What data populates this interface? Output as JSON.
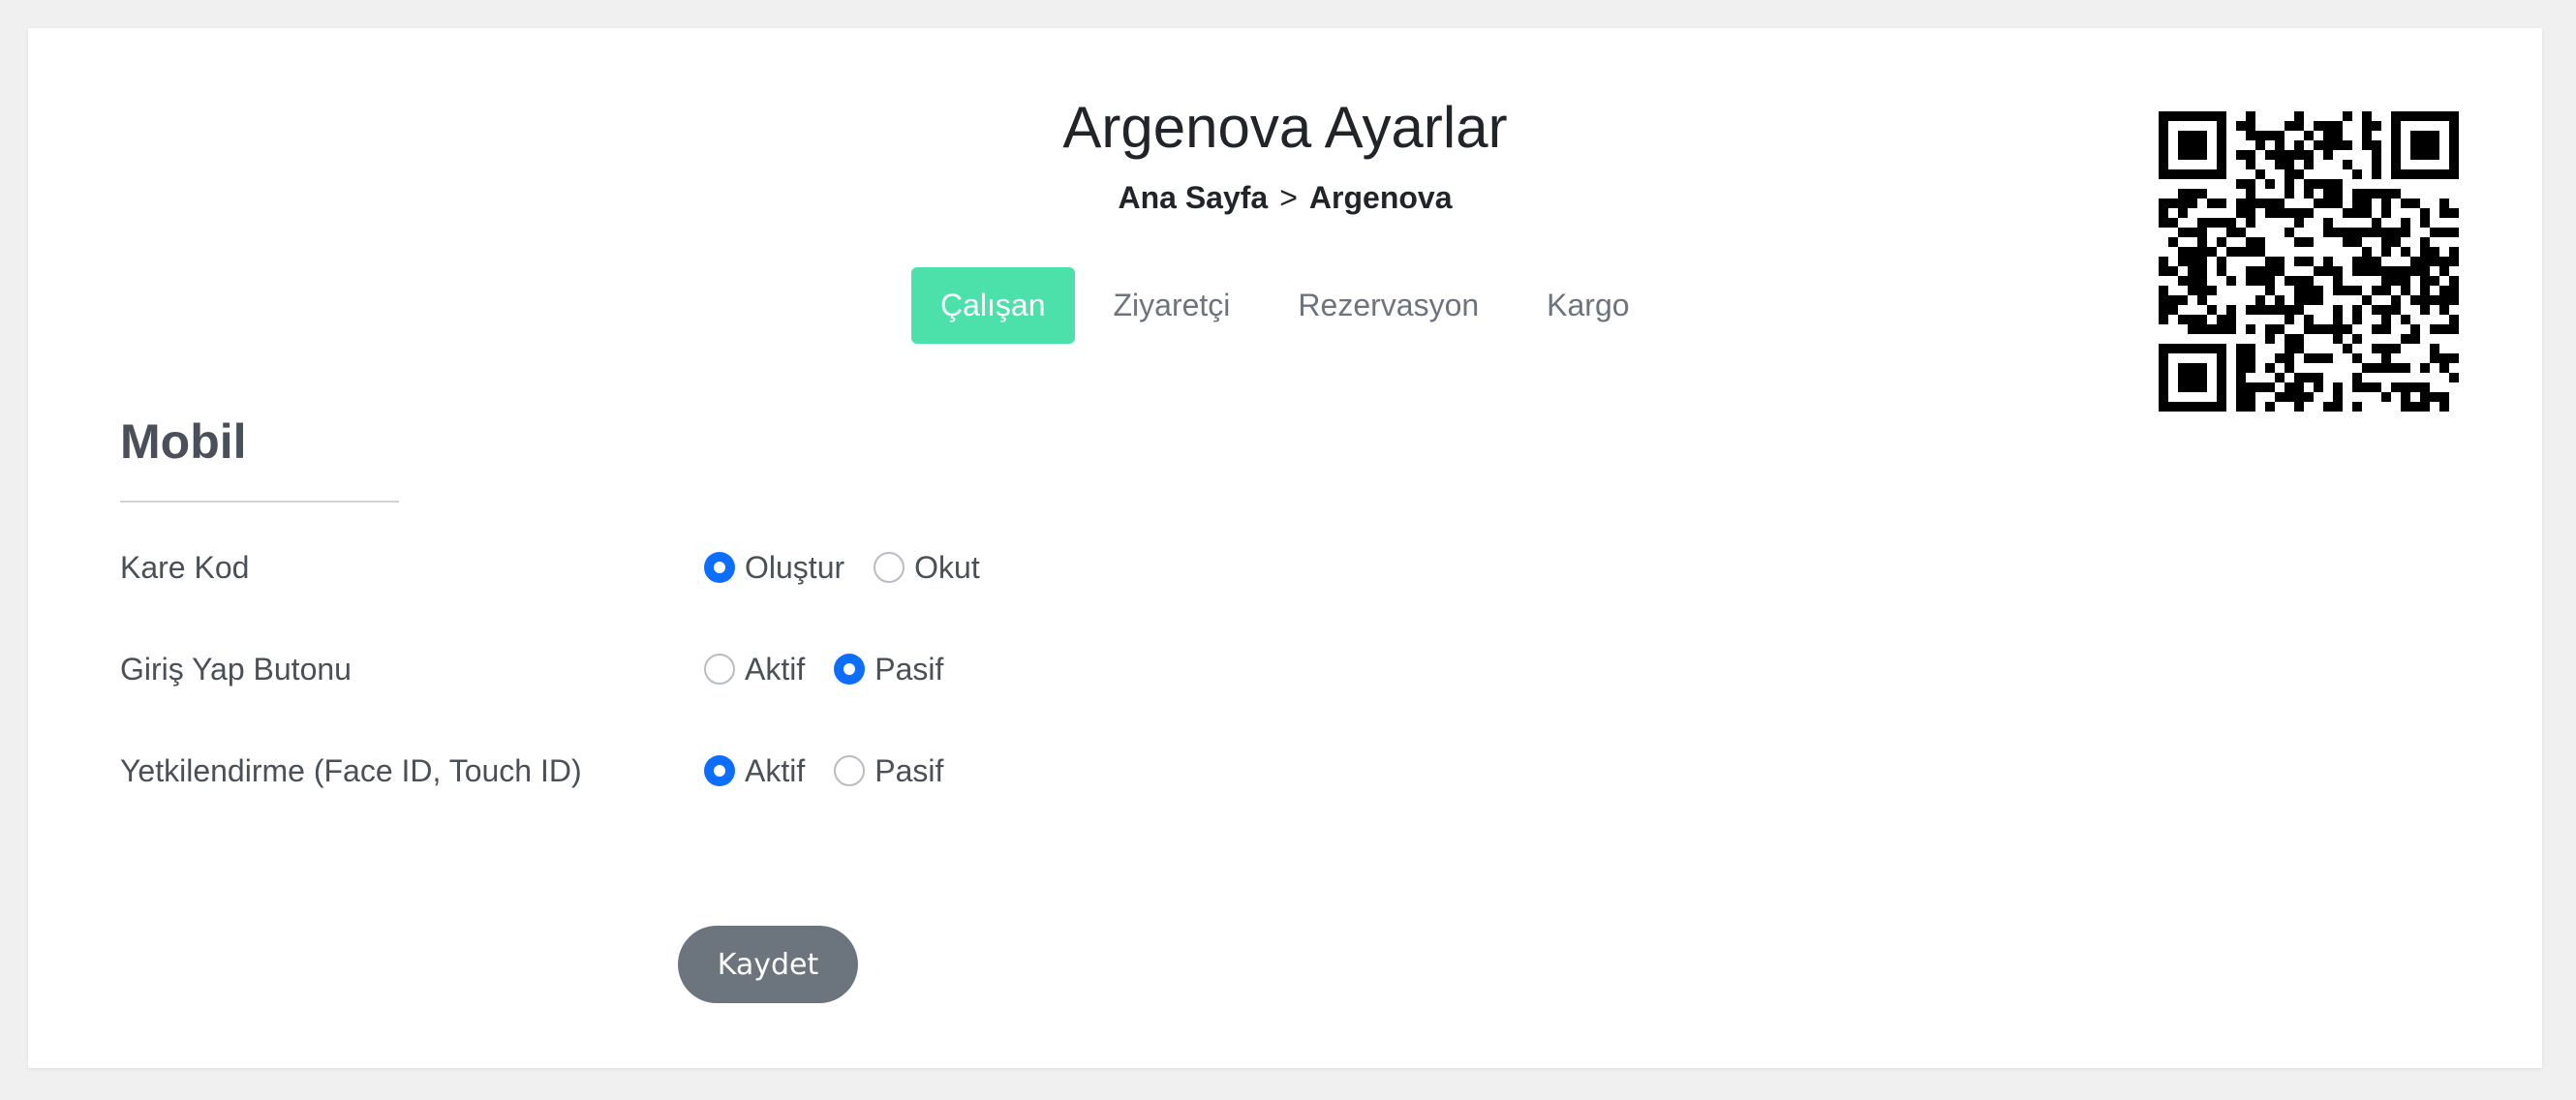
{
  "header": {
    "title": "Argenova Ayarlar",
    "breadcrumb": {
      "home": "Ana Sayfa",
      "separator": ">",
      "current": "Argenova"
    }
  },
  "tabs": [
    {
      "label": "Çalışan",
      "active": true
    },
    {
      "label": "Ziyaretçi",
      "active": false
    },
    {
      "label": "Rezervasyon",
      "active": false
    },
    {
      "label": "Kargo",
      "active": false
    }
  ],
  "qr": {
    "icon": "qr-code-icon"
  },
  "section": {
    "title": "Mobil",
    "settings": [
      {
        "label": "Kare Kod",
        "options": [
          "Oluştur",
          "Okut"
        ],
        "selected": "Oluştur"
      },
      {
        "label": "Giriş Yap Butonu",
        "options": [
          "Aktif",
          "Pasif"
        ],
        "selected": "Pasif"
      },
      {
        "label": "Yetkilendirme (Face ID, Touch ID)",
        "options": [
          "Aktif",
          "Pasif"
        ],
        "selected": "Aktif"
      }
    ]
  },
  "actions": {
    "save_label": "Kaydet"
  },
  "colors": {
    "active_tab": "#4ce0aa",
    "radio_checked": "#0d6efd",
    "save_button": "#6c757d"
  }
}
